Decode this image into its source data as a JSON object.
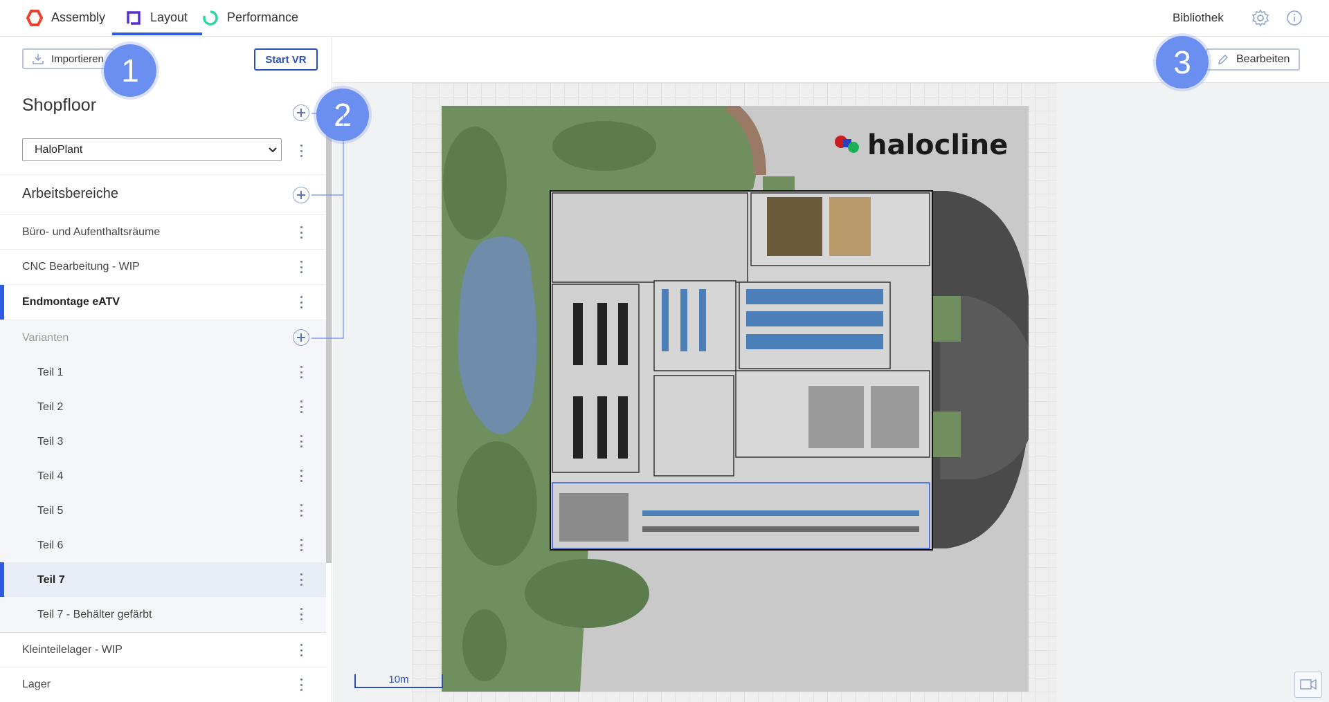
{
  "nav": {
    "tabs": [
      {
        "label": "Assembly",
        "icon": "assembly-icon",
        "color": "#e8432f"
      },
      {
        "label": "Layout",
        "icon": "layout-icon",
        "color": "#5a2fd1",
        "active": true
      },
      {
        "label": "Performance",
        "icon": "performance-icon",
        "color": "#2dd4a0"
      }
    ],
    "library": "Bibliothek",
    "icons": [
      "settings-icon",
      "info-icon"
    ]
  },
  "sidebar": {
    "import_label": "Importieren",
    "vr_label": "Start VR",
    "shopfloor_title": "Shopfloor",
    "shopfloor_select": "HaloPlant",
    "areas_title": "Arbeitsbereiche",
    "areas": [
      {
        "label": "Büro- und Aufenthaltsräume"
      },
      {
        "label": "CNC Bearbeitung - WIP"
      },
      {
        "label": "Endmontage eATV",
        "selected": true
      }
    ],
    "variants_title": "Varianten",
    "variants": [
      {
        "label": "Teil 1"
      },
      {
        "label": "Teil 2"
      },
      {
        "label": "Teil 3"
      },
      {
        "label": "Teil 4"
      },
      {
        "label": "Teil 5"
      },
      {
        "label": "Teil 6"
      },
      {
        "label": "Teil 7",
        "selected": true
      },
      {
        "label": "Teil 7 - Behälter gefärbt"
      }
    ],
    "more_areas": [
      {
        "label": "Kleinteilelager - WIP"
      },
      {
        "label": "Lager"
      }
    ]
  },
  "toolbar": {
    "edit_label": "Bearbeiten"
  },
  "callouts": [
    "1",
    "2",
    "3"
  ],
  "map": {
    "logo_text": "halocline",
    "scale_label": "10m",
    "colors": {
      "grass": "#6f8f5e",
      "water": "#6f8cab",
      "road": "#4a4a4a",
      "accent": "#2d5be3"
    }
  }
}
